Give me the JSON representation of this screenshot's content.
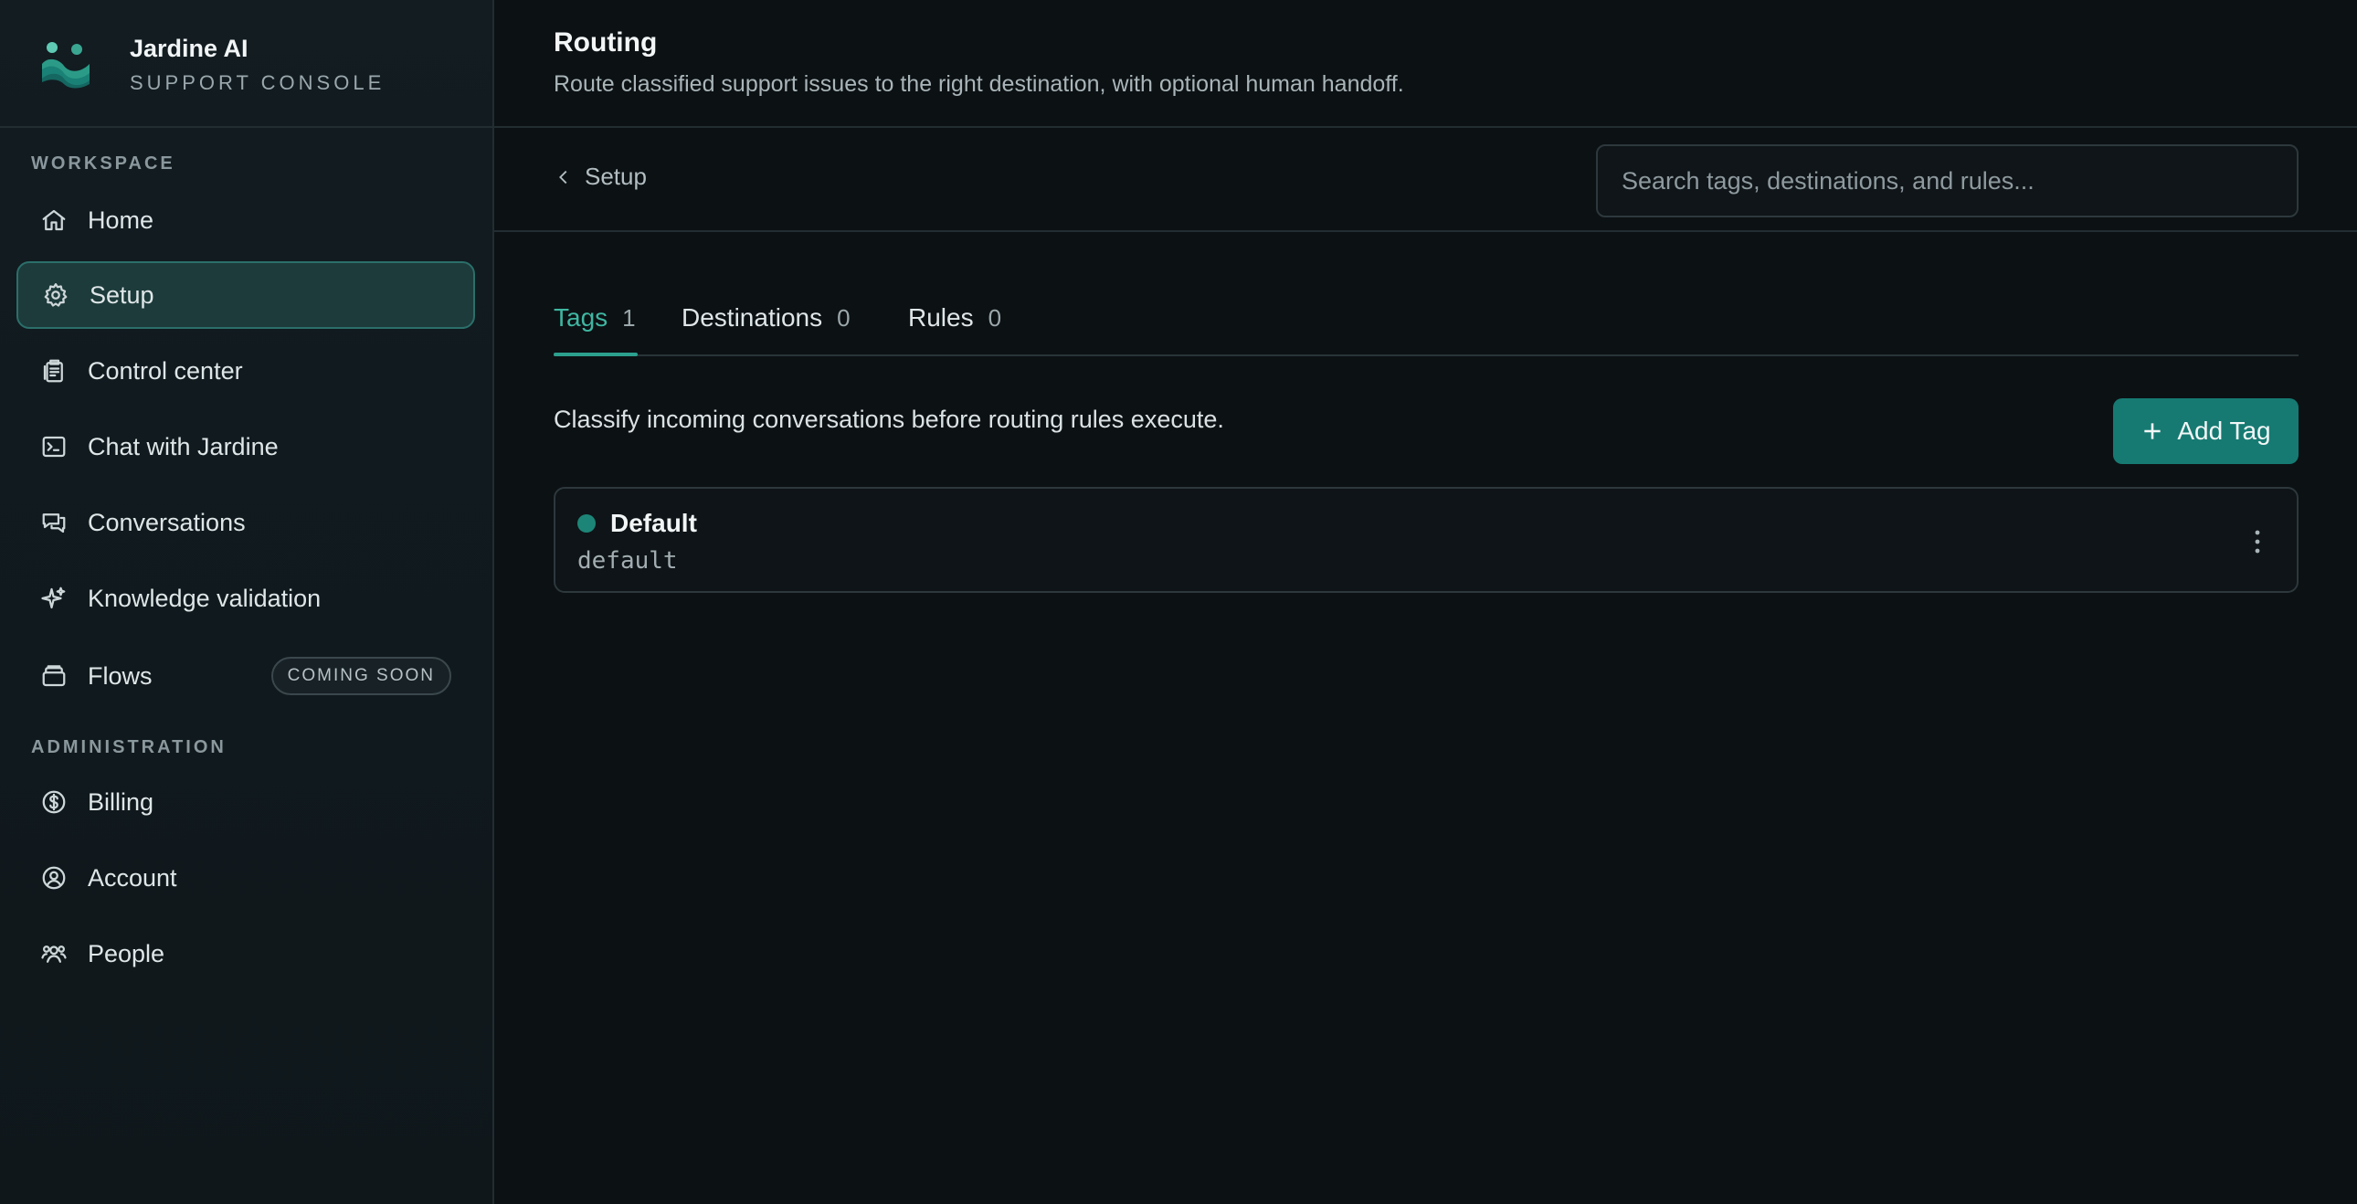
{
  "brand": {
    "name": "Jardine AI",
    "subtitle": "SUPPORT CONSOLE"
  },
  "sidebar": {
    "sections": [
      {
        "label": "WORKSPACE"
      },
      {
        "label": "ADMINISTRATION"
      }
    ],
    "items": [
      {
        "label": "Home",
        "icon": "home-icon"
      },
      {
        "label": "Setup",
        "icon": "gear-icon",
        "active": true
      },
      {
        "label": "Control center",
        "icon": "clipboard-icon"
      },
      {
        "label": "Chat with Jardine",
        "icon": "terminal-icon"
      },
      {
        "label": "Conversations",
        "icon": "chat-bubbles-icon"
      },
      {
        "label": "Knowledge validation",
        "icon": "sparkles-icon"
      },
      {
        "label": "Flows",
        "icon": "layers-icon",
        "badge": "COMING SOON"
      },
      {
        "label": "Billing",
        "icon": "dollar-circle-icon"
      },
      {
        "label": "Account",
        "icon": "user-circle-icon"
      },
      {
        "label": "People",
        "icon": "people-icon"
      }
    ]
  },
  "header": {
    "title": "Routing",
    "description": "Route classified support issues to the right destination, with optional human handoff."
  },
  "toolbar": {
    "back_label": "Setup",
    "search_placeholder": "Search tags, destinations, and rules..."
  },
  "tabs": [
    {
      "label": "Tags",
      "count": "1",
      "active": true
    },
    {
      "label": "Destinations",
      "count": "0"
    },
    {
      "label": "Rules",
      "count": "0"
    }
  ],
  "tags_panel": {
    "description": "Classify incoming conversations before routing rules execute.",
    "add_label": "Add Tag",
    "items": [
      {
        "name": "Default",
        "slug": "default",
        "color": "#1d8577"
      }
    ]
  },
  "colors": {
    "accent": "#167a72",
    "accent_text": "#3fb6a1"
  }
}
